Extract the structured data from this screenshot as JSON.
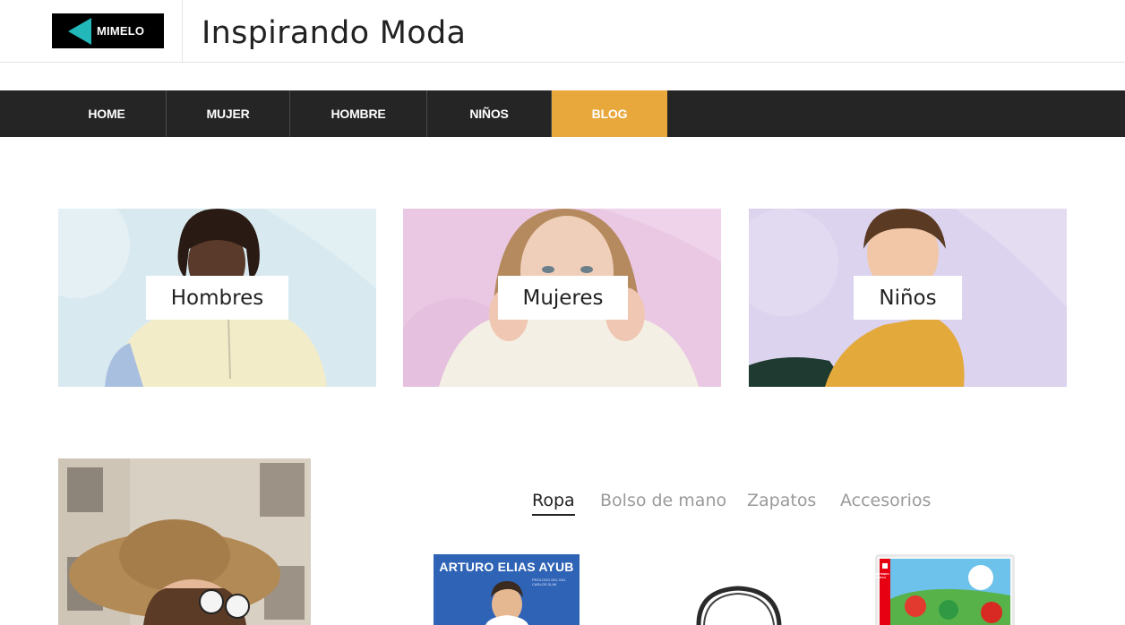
{
  "header": {
    "logo_text": "MIMELO",
    "site_title": "Inspirando Moda"
  },
  "nav": {
    "items": [
      {
        "label": "HOME"
      },
      {
        "label": "MUJER"
      },
      {
        "label": "HOMBRE"
      },
      {
        "label": "NIÑOS"
      },
      {
        "label": "BLOG",
        "active": true
      }
    ]
  },
  "categories": [
    {
      "label": "Hombres",
      "bg": "#d8eaf0"
    },
    {
      "label": "Mujeres",
      "bg": "#eac8e4"
    },
    {
      "label": "Niños",
      "bg": "#dcd3ee"
    }
  ],
  "tabs": [
    {
      "label": "Ropa",
      "active": true
    },
    {
      "label": "Bolso de mano"
    },
    {
      "label": "Zapatos"
    },
    {
      "label": "Accesorios"
    }
  ],
  "products": {
    "book": {
      "author_text": "ARTURO ELIAS AYUB",
      "small_text": "PRÓLOGO DEL ING. CARLOS SLIM"
    },
    "game": {
      "brand_text": "NINTENDO SWITCH"
    }
  },
  "colors": {
    "nav_bg": "#252525",
    "nav_active": "#e8a83b",
    "logo_accent": "#22b7b8"
  }
}
